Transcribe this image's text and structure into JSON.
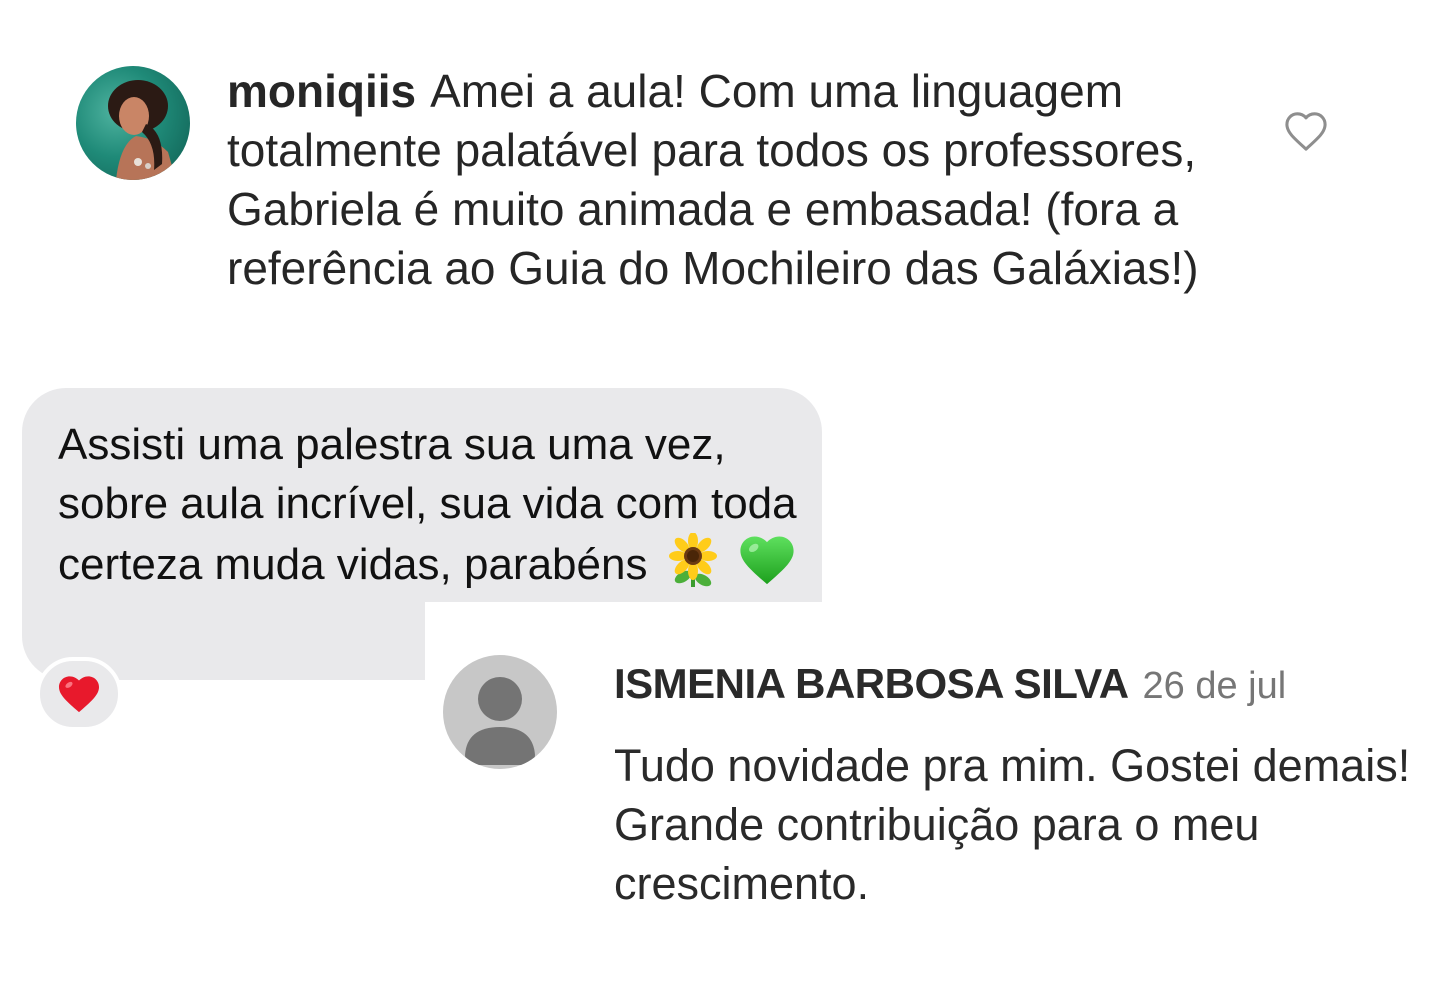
{
  "instagram_comment": {
    "username": "moniqiis",
    "text": "Amei a aula! Com uma linguagem totalmente palatável para todos os professores, Gabriela é muito animada e embasada! (fora a referência ao Guia do Mochileiro das Galáxias!)",
    "like_icon": "heart-outline-icon"
  },
  "message_bubble": {
    "text": "Assisti uma palestra sua uma vez, sobre aula incrível, sua vida com toda certeza muda vidas, parabéns",
    "emojis": [
      "sunflower-emoji",
      "green-heart-emoji"
    ],
    "reaction": "red-heart-icon",
    "bubble_color": "#e9e9eb"
  },
  "google_comment": {
    "name": "ISMENIA BARBOSA SILVA",
    "date": "26 de jul",
    "text": "Tudo novidade pra mim. Gostei demais! Grande contribuição para o meu crescimento.",
    "avatar": "default-person-icon"
  }
}
